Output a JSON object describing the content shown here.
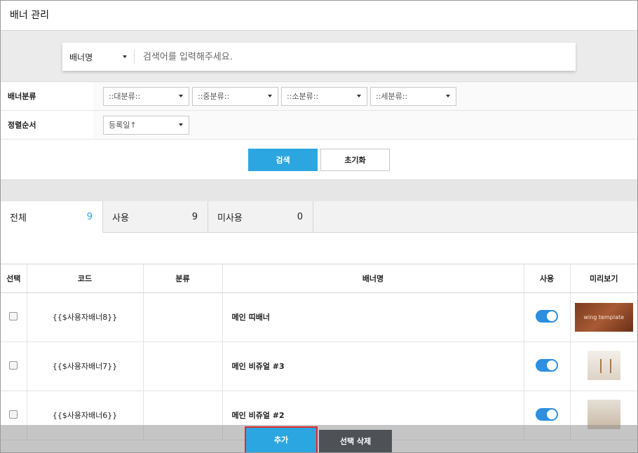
{
  "header": {
    "title": "배너 관리"
  },
  "search": {
    "select_label": "배너명",
    "placeholder": "검색어를 입력해주세요."
  },
  "filters": {
    "category_label": "배너분류",
    "category_dropdowns": [
      "::대분류::",
      "::중분류::",
      "::소분류::",
      "::세분류::"
    ],
    "sort_label": "정렬순서",
    "sort_value": "등록일↑"
  },
  "buttons": {
    "search": "검색",
    "reset": "초기화"
  },
  "tabs": [
    {
      "label": "전체",
      "count": "9"
    },
    {
      "label": "사용",
      "count": "9"
    },
    {
      "label": "미사용",
      "count": "0"
    }
  ],
  "table": {
    "columns": [
      "선택",
      "코드",
      "분류",
      "배너명",
      "사용",
      "미리보기"
    ],
    "rows": [
      {
        "code": "{{$사용자배너8}}",
        "category": "",
        "name": "메인 띠배너",
        "enabled": true,
        "preview_text": "wing template"
      },
      {
        "code": "{{$사용자배너7}}",
        "category": "",
        "name": "메인 비쥬얼 #3",
        "enabled": true,
        "preview_text": ""
      },
      {
        "code": "{{$사용자배너6}}",
        "category": "",
        "name": "메인 비쥬얼 #2",
        "enabled": true,
        "preview_text": ""
      }
    ]
  },
  "bottom": {
    "add": "추가",
    "delete_selected": "선택 삭제"
  },
  "colors": {
    "accent": "#2ca6e0",
    "toggle": "#2c8fe0",
    "dark_button": "#4e5257",
    "highlight": "#e02b2b"
  }
}
